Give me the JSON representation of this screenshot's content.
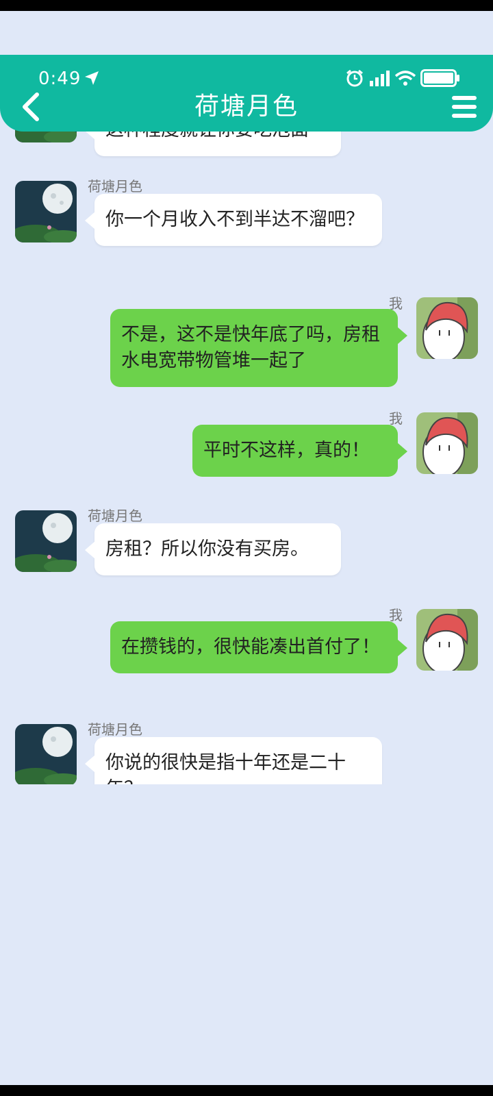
{
  "status_bar": {
    "time": "0:49"
  },
  "header": {
    "title": "荷塘月色"
  },
  "messages": [
    {
      "side": "left",
      "name": "",
      "text": "这种程度就让你要吃泡面"
    },
    {
      "side": "left",
      "name": "荷塘月色",
      "text": "你一个月收入不到半达不溜吧？"
    },
    {
      "side": "right",
      "name": "我",
      "text": "不是，这不是快年底了吗，房租水电宽带物管堆一起了"
    },
    {
      "side": "right",
      "name": "我",
      "text": "平时不这样，真的！"
    },
    {
      "side": "left",
      "name": "荷塘月色",
      "text": "房租？所以你没有买房。"
    },
    {
      "side": "right",
      "name": "我",
      "text": "在攒钱的，很快能凑出首付了！"
    },
    {
      "side": "left",
      "name": "荷塘月色",
      "text": "你说的很快是指十年还是二十年？"
    }
  ],
  "colors": {
    "header": "#10b9a0",
    "background": "#e0e8f8",
    "bubble_self": "#6cd24b",
    "bubble_other": "#ffffff"
  },
  "icons": [
    "back-arrow-icon",
    "menu-icon",
    "location-arrow-icon",
    "alarm-icon",
    "signal-icon",
    "wifi-icon",
    "battery-icon"
  ]
}
